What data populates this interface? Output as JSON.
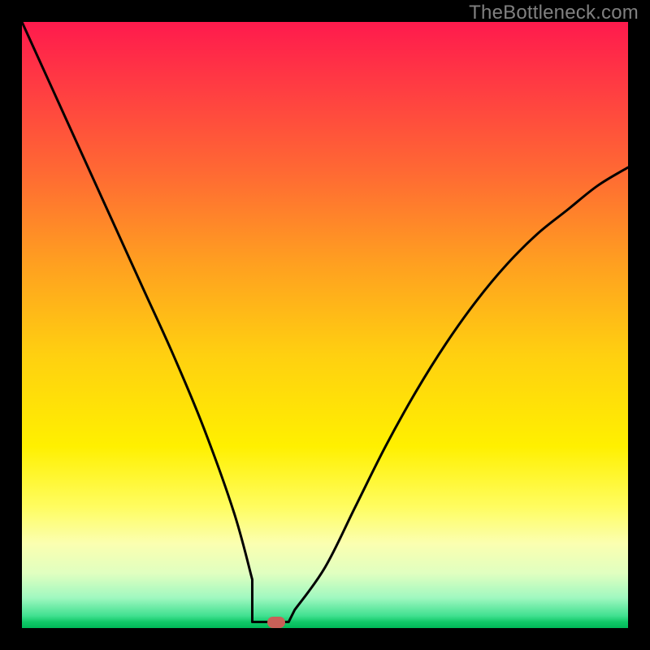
{
  "watermark": "TheBottleneck.com",
  "colors": {
    "frame": "#000000",
    "gradient_top": "#ff1a4d",
    "gradient_bottom": "#00b858",
    "curve": "#000000",
    "marker": "#c86058",
    "watermark": "#808080"
  },
  "chart_data": {
    "type": "line",
    "title": "",
    "xlabel": "",
    "ylabel": "",
    "xlim": [
      0,
      100
    ],
    "ylim": [
      0,
      100
    ],
    "series": [
      {
        "name": "bottleneck-curve",
        "x": [
          0,
          5,
          10,
          15,
          20,
          25,
          30,
          35,
          38,
          40,
          42,
          45,
          50,
          55,
          60,
          65,
          70,
          75,
          80,
          85,
          90,
          95,
          100
        ],
        "values": [
          100,
          89,
          78,
          67,
          56,
          45,
          33,
          19,
          8,
          2,
          1,
          3,
          10,
          20,
          30,
          39,
          47,
          54,
          60,
          65,
          69,
          73,
          76
        ]
      }
    ],
    "marker": {
      "x": 42,
      "y": 1
    },
    "flat_bottom_range_x": [
      38,
      44
    ],
    "grid": false,
    "legend": false
  }
}
